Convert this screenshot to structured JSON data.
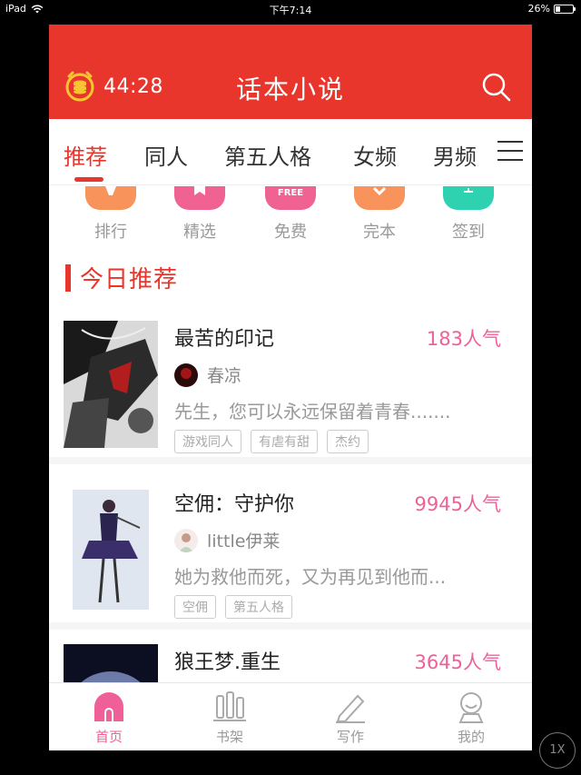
{
  "status": {
    "device": "iPad",
    "time": "下午7:14",
    "battery": "26%",
    "battery_level": 0.26
  },
  "header": {
    "timer": "44:28",
    "title": "话本小说"
  },
  "tabs": [
    {
      "label": "推荐",
      "active": true
    },
    {
      "label": "同人",
      "active": false
    },
    {
      "label": "第五人格",
      "active": false
    },
    {
      "label": "女频",
      "active": false
    },
    {
      "label": "男频",
      "active": false
    }
  ],
  "quicknav": [
    {
      "label": "排行",
      "color": "#f7935b"
    },
    {
      "label": "精选",
      "color": "#f06292"
    },
    {
      "label": "免费",
      "color": "#f06292",
      "badge": "FREE"
    },
    {
      "label": "完本",
      "color": "#f7935b"
    },
    {
      "label": "签到",
      "color": "#2ed1b0"
    }
  ],
  "section": {
    "title": "今日推荐"
  },
  "books": [
    {
      "title": "最苦的印记",
      "popularity": "183人气",
      "author": "春凉",
      "desc": "先生，您可以永远保留着青春.......",
      "tags": [
        "游戏同人",
        "有虐有甜",
        "杰约"
      ]
    },
    {
      "title": "空佣：守护你",
      "popularity": "9945人气",
      "author": "little伊莱",
      "desc": "她为救他而死，又为再见到他而...",
      "tags": [
        "空佣",
        "第五人格"
      ]
    },
    {
      "title": "狼王梦.重生",
      "popularity": "3645人气",
      "author": "",
      "desc": "",
      "tags": []
    }
  ],
  "bottomnav": [
    {
      "label": "首页",
      "active": true
    },
    {
      "label": "书架",
      "active": false
    },
    {
      "label": "写作",
      "active": false
    },
    {
      "label": "我的",
      "active": false
    }
  ],
  "overlay": {
    "speed": "1X"
  },
  "colors": {
    "brand": "#e8362c",
    "pink": "#ef5f98"
  }
}
